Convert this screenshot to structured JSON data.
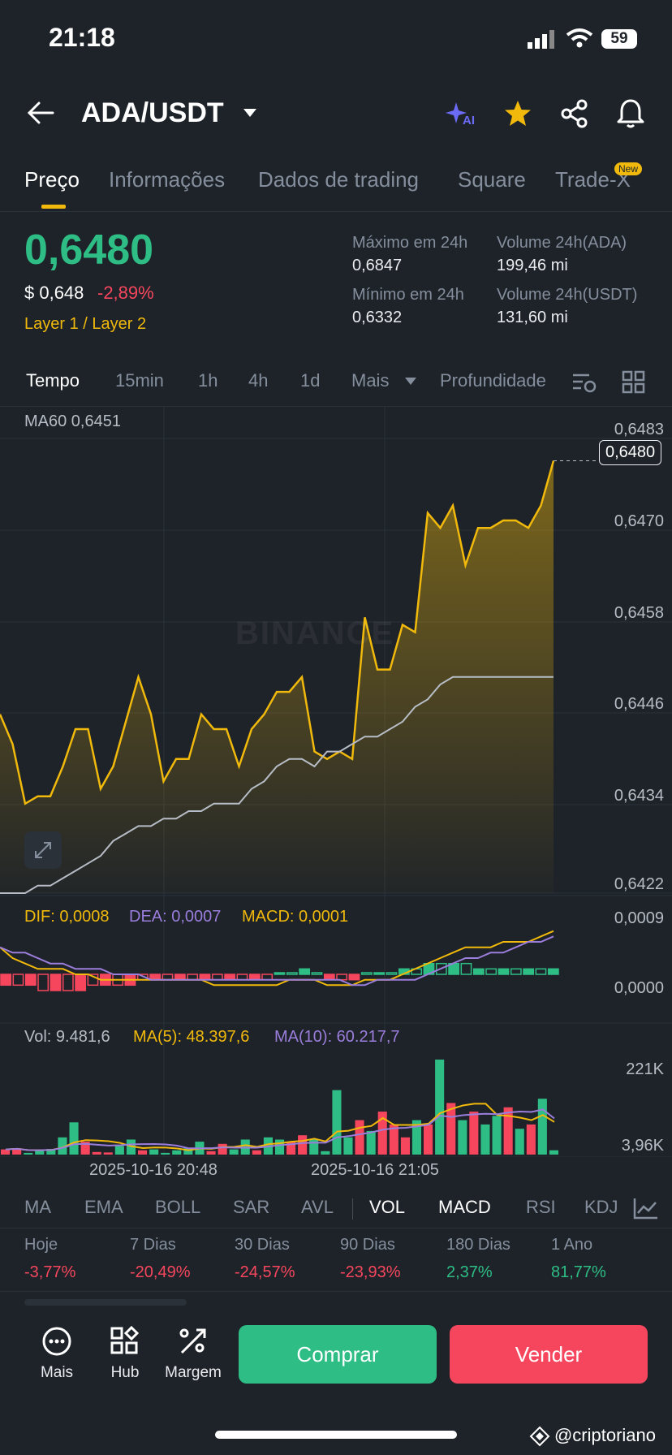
{
  "status": {
    "time": "21:18",
    "battery": "59"
  },
  "header": {
    "pair": "ADA/USDT",
    "ai_label": "AI"
  },
  "tabs": [
    {
      "label": "Preço"
    },
    {
      "label": "Informações"
    },
    {
      "label": "Dados de trading"
    },
    {
      "label": "Square"
    },
    {
      "label": "Trade-X"
    }
  ],
  "new_badge": "New",
  "price": {
    "last": "0,6480",
    "usd": "$ 0,648",
    "change": "-2,89%",
    "tags": "Layer 1 / Layer 2"
  },
  "stats": {
    "high_label": "Máximo em 24h",
    "high": "0,6847",
    "low_label": "Mínimo em 24h",
    "low": "0,6332",
    "vol_base_label": "Volume 24h(ADA)",
    "vol_base": "199,46 mi",
    "vol_quote_label": "Volume 24h(USDT)",
    "vol_quote": "131,60 mi"
  },
  "timeframes": [
    "Tempo",
    "15min",
    "1h",
    "4h",
    "1d",
    "Mais",
    "Profundidade"
  ],
  "colors": {
    "up": "#2ebd85",
    "down": "#f6465d",
    "accent": "#f0b90b",
    "purple": "#9b7ddb"
  },
  "chart_data": {
    "type": "line",
    "watermark": "BINANCE",
    "ma_label": "MA60 0,6451",
    "current_price": "0,6480",
    "y_ticks": [
      "0,6483",
      "0,6470",
      "0,6458",
      "0,6446",
      "0,6434",
      "0,6422"
    ],
    "ylim": [
      0.6422,
      0.6483
    ],
    "x_ticks": [
      "2025-10-16 20:48",
      "2025-10-16 21:05"
    ],
    "series": [
      {
        "values": [
          0.6446,
          0.6442,
          0.6434,
          0.6435,
          0.6435,
          0.6439,
          0.6444,
          0.6444,
          0.6436,
          0.6439,
          0.6445,
          0.6451,
          0.6446,
          0.6437,
          0.644,
          0.644,
          0.6446,
          0.6444,
          0.6444,
          0.6439,
          0.6444,
          0.6446,
          0.6449,
          0.6449,
          0.6451,
          0.6441,
          0.644,
          0.6441,
          0.644,
          0.6459,
          0.6452,
          0.6452,
          0.6458,
          0.6457,
          0.6473,
          0.6471,
          0.6474,
          0.6466,
          0.6471,
          0.6471,
          0.6472,
          0.6472,
          0.6471,
          0.6474,
          0.648
        ]
      },
      {
        "values": [
          0.6422,
          0.6422,
          0.6422,
          0.6423,
          0.6423,
          0.6424,
          0.6425,
          0.6426,
          0.6427,
          0.6429,
          0.643,
          0.6431,
          0.6431,
          0.6432,
          0.6432,
          0.6433,
          0.6433,
          0.6434,
          0.6434,
          0.6434,
          0.6436,
          0.6437,
          0.6439,
          0.644,
          0.644,
          0.6439,
          0.6441,
          0.6441,
          0.6442,
          0.6443,
          0.6443,
          0.6444,
          0.6445,
          0.6447,
          0.6448,
          0.645,
          0.6451,
          0.6451,
          0.6451,
          0.6451,
          0.6451,
          0.6451,
          0.6451,
          0.6451,
          0.6451
        ]
      }
    ],
    "macd": {
      "dif_label": "DIF: 0,0008",
      "dea_label": "DEA: 0,0007",
      "macd_label": "MACD: 0,0001",
      "y_ticks": [
        "0,0009",
        "0,0000"
      ],
      "ylim": [
        -0.0006,
        0.0009
      ],
      "dif": [
        0.0005,
        0.0003,
        0.0002,
        0.0001,
        0.0001,
        0.0001,
        0.0,
        0.0,
        -0.0001,
        -0.0001,
        -0.0001,
        -0.0001,
        -0.0001,
        -0.0001,
        -0.0001,
        -0.0001,
        -0.0001,
        -0.0002,
        -0.0002,
        -0.0002,
        -0.0002,
        -0.0002,
        -0.0002,
        -0.0001,
        -0.0001,
        -0.0001,
        -0.0002,
        -0.0002,
        -0.0002,
        -0.0001,
        -0.0001,
        -0.0001,
        0.0,
        0.0001,
        0.0002,
        0.0003,
        0.0004,
        0.0005,
        0.0005,
        0.0005,
        0.0006,
        0.0006,
        0.0006,
        0.0007,
        0.0008
      ],
      "dea": [
        0.0005,
        0.0004,
        0.0004,
        0.0003,
        0.0002,
        0.0002,
        0.0001,
        0.0001,
        0.0001,
        0.0,
        0.0,
        0.0,
        -0.0001,
        -0.0001,
        -0.0001,
        -0.0001,
        -0.0001,
        -0.0001,
        -0.0001,
        -0.0001,
        -0.0001,
        -0.0001,
        -0.0001,
        -0.0001,
        -0.0001,
        -0.0001,
        -0.0001,
        -0.0001,
        -0.0002,
        -0.0002,
        -0.0001,
        -0.0001,
        -0.0001,
        -0.0001,
        0.0,
        0.0001,
        0.0002,
        0.0003,
        0.0003,
        0.0004,
        0.0004,
        0.0005,
        0.0006,
        0.0006,
        0.0007
      ],
      "hist": [
        -0.0002,
        -0.0002,
        -0.0002,
        -0.0003,
        -0.0003,
        -0.0003,
        -0.0003,
        -0.0002,
        -0.0002,
        -0.0002,
        -0.0002,
        -0.0001,
        -0.0001,
        -0.0001,
        -0.0001,
        -0.0001,
        -0.0001,
        -0.0001,
        -0.0001,
        -0.0001,
        -0.0001,
        -0.0001,
        0.0,
        0.0,
        0.0001,
        0.0,
        -0.0001,
        -0.0001,
        -0.0001,
        0.0,
        0.0,
        0.0,
        0.0001,
        0.0001,
        0.0002,
        0.0002,
        0.0002,
        0.0002,
        0.0001,
        0.0001,
        0.0001,
        0.0001,
        0.0001,
        0.0001,
        0.0001
      ]
    },
    "volume": {
      "vol_label": "Vol: 9.481,6",
      "ma5_label": "MA(5): 48.397,6",
      "ma10_label": "MA(10): 60.217,7",
      "y_ticks": [
        "221K",
        "3,96K"
      ],
      "ylim": [
        0,
        221000
      ],
      "bars": [
        12000,
        15000,
        4000,
        10000,
        13000,
        40000,
        75000,
        30000,
        6000,
        5000,
        20000,
        35000,
        10000,
        12000,
        4000,
        10000,
        15000,
        30000,
        8000,
        25000,
        12000,
        35000,
        10000,
        40000,
        35000,
        30000,
        45000,
        35000,
        8000,
        150000,
        40000,
        80000,
        55000,
        100000,
        70000,
        40000,
        80000,
        70000,
        221000,
        120000,
        80000,
        100000,
        70000,
        90000,
        110000,
        60000,
        70000,
        130000,
        10000
      ],
      "bar_up": [
        0,
        0,
        1,
        1,
        1,
        1,
        1,
        0,
        0,
        0,
        1,
        1,
        0,
        1,
        1,
        1,
        1,
        1,
        0,
        0,
        1,
        1,
        0,
        1,
        1,
        0,
        0,
        1,
        1,
        1,
        1,
        0,
        1,
        0,
        0,
        0,
        1,
        0,
        1,
        0,
        1,
        0,
        1,
        1,
        0,
        1,
        0,
        1,
        1
      ]
    }
  },
  "indicators": [
    "MA",
    "EMA",
    "BOLL",
    "SAR",
    "AVL",
    "VOL",
    "MACD",
    "RSI",
    "KDJ"
  ],
  "performance": [
    {
      "label": "Hoje",
      "value": "-3,77%"
    },
    {
      "label": "7 Dias",
      "value": "-20,49%"
    },
    {
      "label": "30 Dias",
      "value": "-24,57%"
    },
    {
      "label": "90 Dias",
      "value": "-23,93%"
    },
    {
      "label": "180 Dias",
      "value": "2,37%"
    },
    {
      "label": "1 Ano",
      "value": "81,77%"
    }
  ],
  "bottom": {
    "more": "Mais",
    "hub": "Hub",
    "margin": "Margem",
    "buy": "Comprar",
    "sell": "Vender"
  },
  "watermark_user": "@criptoriano"
}
